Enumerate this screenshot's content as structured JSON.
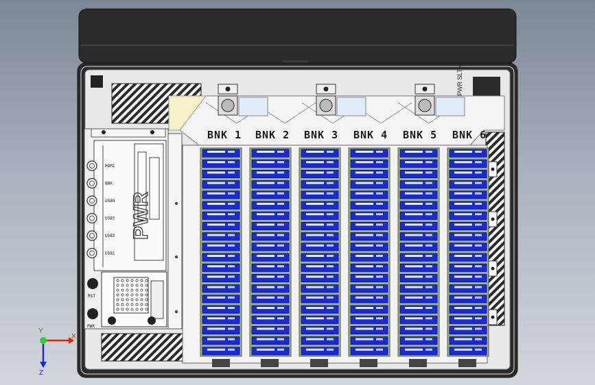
{
  "banks": {
    "labels": [
      "BNK 1",
      "BNK 2",
      "BNK 3",
      "BNK 4",
      "BNK 5",
      "BNK 6"
    ],
    "slots_per_bank": 20
  },
  "side_label": "PWR SLTN",
  "ports": {
    "labels": [
      "HDMI",
      "BNK",
      "USB4",
      "USB3",
      "USB2",
      "USB1"
    ]
  },
  "buttons": {
    "rst": "RST",
    "pwr": "PWR"
  },
  "board_logo": "PWR",
  "axes": {
    "x": "X",
    "y": "Y",
    "z": "Z"
  },
  "colors": {
    "drive_blue": "#1a2ad8",
    "rail_green": "#9bb28c",
    "housing": "#2b2b2b",
    "plate": "#f2f2f2"
  }
}
